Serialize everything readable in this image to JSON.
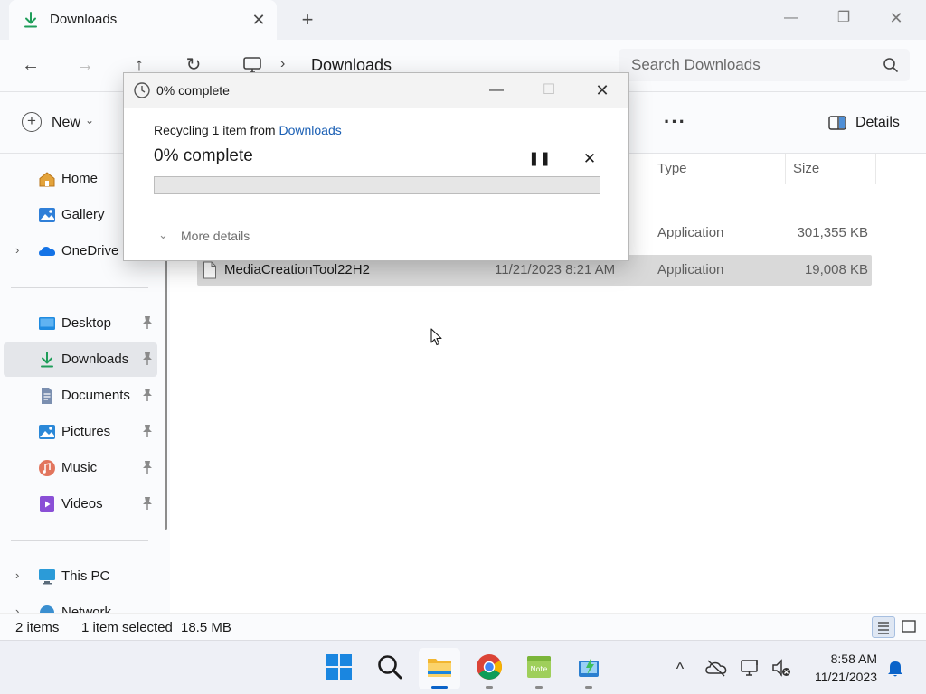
{
  "window": {
    "tab_title": "Downloads",
    "new_tab_symbol": "+",
    "tab_close_symbol": "✕",
    "minimize_symbol": "—",
    "maximize_symbol": "❐",
    "close_symbol": "✕"
  },
  "address": {
    "back_symbol": "←",
    "forward_symbol": "→",
    "up_symbol": "↑",
    "refresh_symbol": "↻",
    "breadcrumb_chevron": "›",
    "breadcrumb": "Downloads",
    "search_placeholder": "Search Downloads"
  },
  "commandbar": {
    "new_label": "New",
    "new_chevron": "⌄",
    "more_symbol": "···",
    "details_label": "Details"
  },
  "sidebar": {
    "items": [
      {
        "label": "Home",
        "icon": "home-icon",
        "expander": "",
        "pinned": false
      },
      {
        "label": "Gallery",
        "icon": "gallery-icon",
        "expander": "",
        "pinned": false
      },
      {
        "label": "OneDrive",
        "icon": "onedrive-icon",
        "expander": "›",
        "pinned": false
      },
      {
        "label": "Desktop",
        "icon": "desktop-icon",
        "expander": "",
        "pinned": true
      },
      {
        "label": "Downloads",
        "icon": "downloads-icon",
        "expander": "",
        "pinned": true,
        "selected": true
      },
      {
        "label": "Documents",
        "icon": "documents-icon",
        "expander": "",
        "pinned": true
      },
      {
        "label": "Pictures",
        "icon": "pictures-icon",
        "expander": "",
        "pinned": true
      },
      {
        "label": "Music",
        "icon": "music-icon",
        "expander": "",
        "pinned": true
      },
      {
        "label": "Videos",
        "icon": "videos-icon",
        "expander": "",
        "pinned": true
      },
      {
        "label": "This PC",
        "icon": "this-pc-icon",
        "expander": "›",
        "pinned": false
      },
      {
        "label": "Network",
        "icon": "network-icon",
        "expander": "›",
        "pinned": false
      }
    ]
  },
  "filelist": {
    "columns": {
      "type": "Type",
      "size": "Size"
    },
    "rows": [
      {
        "name": "",
        "date": "",
        "type": "Application",
        "size": "301,355 KB",
        "selected": false
      },
      {
        "name": "MediaCreationTool22H2",
        "date": "11/21/2023 8:21 AM",
        "type": "Application",
        "size": "19,008 KB",
        "selected": true
      }
    ]
  },
  "statusbar": {
    "item_count": "2 items",
    "selection": "1 item selected",
    "selection_size": "18.5 MB"
  },
  "dialog": {
    "title": "0% complete",
    "minimize_symbol": "—",
    "maximize_symbol": "☐",
    "close_symbol": "✕",
    "line_prefix": "Recycling 1 item from ",
    "line_link": "Downloads",
    "percent_text": "0% complete",
    "progress": 0,
    "pause_symbol": "❚❚",
    "cancel_symbol": "✕",
    "more_chevron": "⌄",
    "more_details": "More details"
  },
  "taskbar": {
    "apps": [
      "start-icon",
      "search-icon",
      "file-explorer-icon",
      "chrome-icon",
      "notepad-icon",
      "app-icon"
    ],
    "tray_chevron": "^",
    "time": "8:58 AM",
    "date": "11/21/2023"
  },
  "colors": {
    "accent": "#0a63c9",
    "link": "#1a5fb4",
    "download_arrow": "#1f9e5a",
    "progress_fill": "#06b025",
    "selection": "#d9d9d9"
  }
}
